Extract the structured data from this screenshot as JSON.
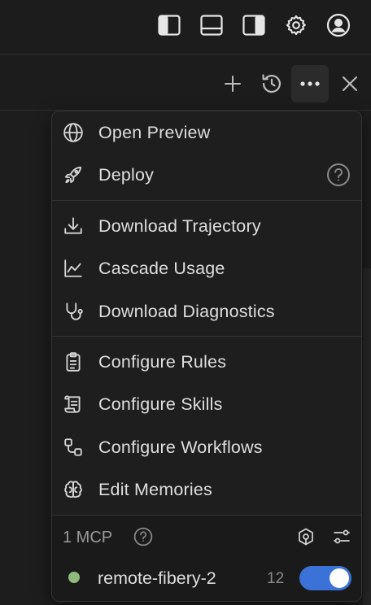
{
  "menu": {
    "items": [
      {
        "label": "Open Preview",
        "icon": "globe-icon"
      },
      {
        "label": "Deploy",
        "icon": "rocket-icon"
      },
      {
        "label": "Download Trajectory",
        "icon": "download-icon"
      },
      {
        "label": "Cascade Usage",
        "icon": "line-chart-icon"
      },
      {
        "label": "Download Diagnostics",
        "icon": "stethoscope-icon"
      },
      {
        "label": "Configure Rules",
        "icon": "clipboard-icon"
      },
      {
        "label": "Configure Skills",
        "icon": "scroll-icon"
      },
      {
        "label": "Configure Workflows",
        "icon": "workflow-icon"
      },
      {
        "label": "Edit Memories",
        "icon": "brain-icon"
      }
    ]
  },
  "mcp": {
    "title": "1 MCP",
    "server": {
      "name": "remote-fibery-2",
      "count": "12",
      "enabled": true,
      "status_color": "#8fba7c"
    }
  },
  "colors": {
    "accent": "#3a72d8",
    "background": "#1d1d1d",
    "menu_bg": "#1e1e1e"
  }
}
